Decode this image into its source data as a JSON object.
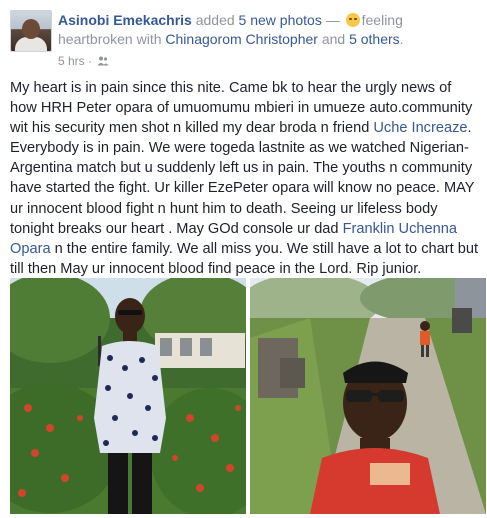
{
  "post": {
    "author": "Asinobi Emekachris",
    "added_text": " added ",
    "photos_text": "5 new photos",
    "feeling_prefix": " — ",
    "feeling_text": "feeling",
    "feeling_line2": "heartbroken with ",
    "tagged": "Chinagorom Christopher",
    "and_text": " and ",
    "others": "5 others",
    "period": ".",
    "time": "5 hrs",
    "separator": " · ",
    "body_1": "My heart is in pain since this nite. Came bk to hear the urgly news of how HRH Peter opara of umuomumu mbieri in umueze auto.community wit his security men shot n killed my dear broda n friend ",
    "mention_1": "Uche Increaze",
    "body_2": ". Everybody is in pain. We were togeda lastnite as we watched Nigerian-Argentina match but u suddenly left us in pain. The youths n community have started the fight. Ur killer EzePeter opara will know no peace. MAY ur innocent blood fight n hunt him to death. Seeing ur lifeless body tonight breaks our heart . May GOd console ur dad ",
    "mention_2": "Franklin Uchenna Opara",
    "body_3": " n the entire family. We all miss you. We still have a lot to chart but till then May ur innocent blood find peace in the Lord. Rip junior."
  },
  "icons": {
    "feeling": "heartbroken-emoji-icon",
    "audience": "friends-audience-icon"
  },
  "colors": {
    "link": "#365899",
    "meta": "#90949c",
    "text": "#1d2129"
  }
}
